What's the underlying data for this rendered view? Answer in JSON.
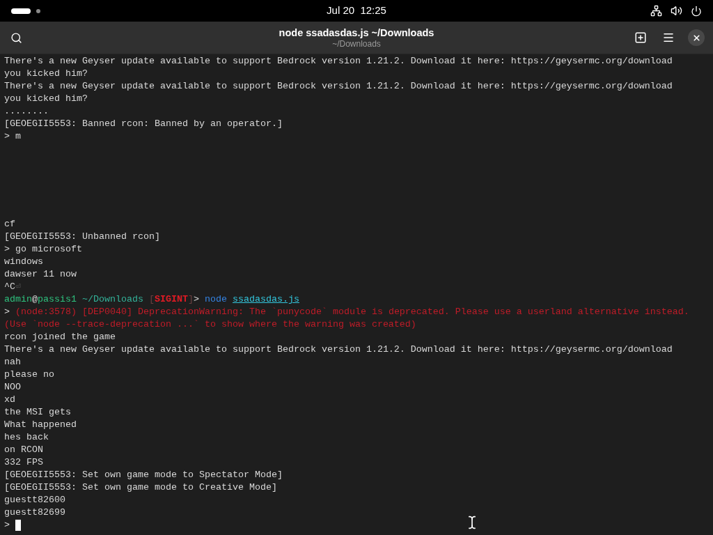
{
  "top_bar": {
    "clock": "Jul 20  12:25"
  },
  "window": {
    "title": "node ssadasdas.js ~/Downloads",
    "subtitle": "~/Downloads"
  },
  "terminal": {
    "lines": [
      {
        "kind": "text",
        "segments": [
          {
            "kind": "plain",
            "text": "There's a new Geyser update available to support Bedrock version 1.21.2. Download it here: https://geysermc.org/download"
          }
        ]
      },
      {
        "kind": "text",
        "segments": [
          {
            "kind": "plain",
            "text": "you kicked him?"
          }
        ]
      },
      {
        "kind": "text",
        "segments": [
          {
            "kind": "plain",
            "text": "There's a new Geyser update available to support Bedrock version 1.21.2. Download it here: https://geysermc.org/download"
          }
        ]
      },
      {
        "kind": "text",
        "segments": [
          {
            "kind": "plain",
            "text": "you kicked him?"
          }
        ]
      },
      {
        "kind": "text",
        "segments": [
          {
            "kind": "plain",
            "text": "........"
          }
        ]
      },
      {
        "kind": "text",
        "segments": [
          {
            "kind": "plain",
            "text": "[GEOEGII5553: Banned rcon: Banned by an operator.]"
          }
        ]
      },
      {
        "kind": "text",
        "segments": [
          {
            "kind": "plain",
            "text": "> m"
          }
        ]
      },
      {
        "kind": "blank"
      },
      {
        "kind": "blank"
      },
      {
        "kind": "blank"
      },
      {
        "kind": "blank"
      },
      {
        "kind": "blank"
      },
      {
        "kind": "blank"
      },
      {
        "kind": "text",
        "segments": [
          {
            "kind": "plain",
            "text": "cf"
          }
        ]
      },
      {
        "kind": "text",
        "segments": [
          {
            "kind": "plain",
            "text": "[GEOEGII5553: Unbanned rcon]"
          }
        ]
      },
      {
        "kind": "text",
        "segments": [
          {
            "kind": "plain",
            "text": "> go microsoft"
          }
        ]
      },
      {
        "kind": "text",
        "segments": [
          {
            "kind": "plain",
            "text": "windows"
          }
        ]
      },
      {
        "kind": "text",
        "segments": [
          {
            "kind": "plain",
            "text": "dawser 11 now"
          }
        ]
      },
      {
        "kind": "text",
        "segments": [
          {
            "kind": "plain",
            "text": "^C"
          },
          {
            "kind": "dim",
            "text": "⏎"
          }
        ]
      },
      {
        "kind": "text",
        "segments": [
          {
            "kind": "user",
            "text": "admin"
          },
          {
            "kind": "plain",
            "text": "@"
          },
          {
            "kind": "user",
            "text": "passis1"
          },
          {
            "kind": "path",
            "text": "~/Downloads",
            "spaced": true
          },
          {
            "kind": "bracket",
            "text": "[",
            "spaced": true
          },
          {
            "kind": "sigint",
            "text": "SIGINT"
          },
          {
            "kind": "bracket",
            "text": "]"
          },
          {
            "kind": "plain",
            "text": ">"
          },
          {
            "kind": "command",
            "text": "node",
            "spaced": true
          },
          {
            "kind": "file",
            "text": "ssadasdas.js",
            "spaced": true
          }
        ]
      },
      {
        "kind": "text",
        "segments": [
          {
            "kind": "plain",
            "text": ">"
          },
          {
            "kind": "error",
            "text": "(node:3578) [DEP0040] DeprecationWarning: The `punycode` module is deprecated. Please use a userland alternative instead.",
            "spaced": true
          }
        ]
      },
      {
        "kind": "text",
        "segments": [
          {
            "kind": "error",
            "text": "(Use `node --trace-deprecation ...` to show where the warning was created)"
          }
        ]
      },
      {
        "kind": "text",
        "segments": [
          {
            "kind": "plain",
            "text": "rcon joined the game"
          }
        ]
      },
      {
        "kind": "text",
        "segments": [
          {
            "kind": "plain",
            "text": "There's a new Geyser update available to support Bedrock version 1.21.2. Download it here: https://geysermc.org/download"
          }
        ]
      },
      {
        "kind": "text",
        "segments": [
          {
            "kind": "plain",
            "text": "nah"
          }
        ]
      },
      {
        "kind": "text",
        "segments": [
          {
            "kind": "plain",
            "text": "please no"
          }
        ]
      },
      {
        "kind": "text",
        "segments": [
          {
            "kind": "plain",
            "text": "NOO"
          }
        ]
      },
      {
        "kind": "text",
        "segments": [
          {
            "kind": "plain",
            "text": "xd"
          }
        ]
      },
      {
        "kind": "text",
        "segments": [
          {
            "kind": "plain",
            "text": "the MSI gets"
          }
        ]
      },
      {
        "kind": "text",
        "segments": [
          {
            "kind": "plain",
            "text": "What happened"
          }
        ]
      },
      {
        "kind": "text",
        "segments": [
          {
            "kind": "plain",
            "text": "hes back"
          }
        ]
      },
      {
        "kind": "text",
        "segments": [
          {
            "kind": "plain",
            "text": "on RCON"
          }
        ]
      },
      {
        "kind": "text",
        "segments": [
          {
            "kind": "plain",
            "text": "332 FPS"
          }
        ]
      },
      {
        "kind": "text",
        "segments": [
          {
            "kind": "plain",
            "text": "[GEOEGII5553: Set own game mode to Spectator Mode]"
          }
        ]
      },
      {
        "kind": "text",
        "segments": [
          {
            "kind": "plain",
            "text": "[GEOEGII5553: Set own game mode to Creative Mode]"
          }
        ]
      },
      {
        "kind": "text",
        "segments": [
          {
            "kind": "plain",
            "text": "guestt82600"
          }
        ]
      },
      {
        "kind": "text",
        "segments": [
          {
            "kind": "plain",
            "text": "guestt82699"
          }
        ]
      },
      {
        "kind": "input",
        "segments": [
          {
            "kind": "plain",
            "text": ">"
          }
        ]
      }
    ]
  }
}
